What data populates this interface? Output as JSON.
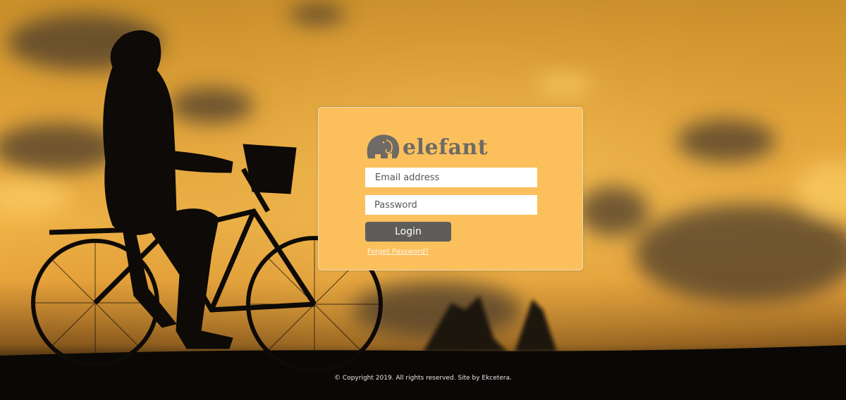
{
  "brand": {
    "name": "elefant",
    "icon": "elephant-icon",
    "text_color": "#6e6a66"
  },
  "login_form": {
    "email_placeholder": "Email address",
    "email_value": "",
    "password_placeholder": "Password",
    "password_value": "",
    "login_label": "Login",
    "forgot_label": "Forget Password?",
    "panel_color": "#fbc05c",
    "button_color": "#5f5d5b"
  },
  "footer": {
    "text": "© Copyright 2019. All rights reserved. Site by Ekcetera."
  },
  "background": {
    "description_icon": "cyclist-sunset-photo",
    "sky_color": "#f2b64a"
  }
}
